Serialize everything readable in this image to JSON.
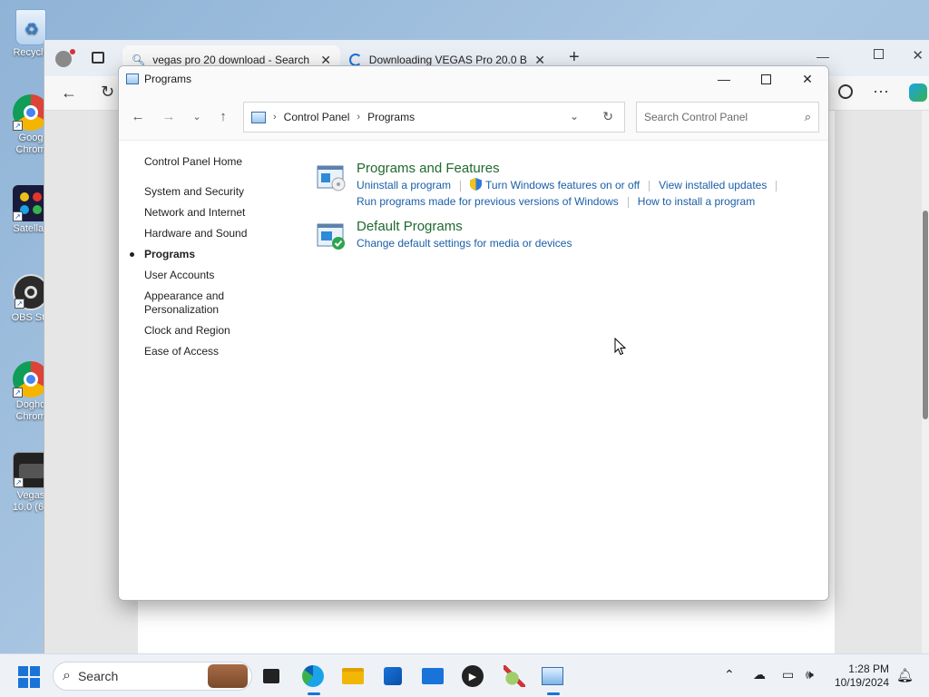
{
  "desktop": {
    "icons": [
      {
        "label": "Recycle",
        "icon": "recycle-bin-icon"
      },
      {
        "label": "Goog Chrom",
        "icon": "chrome-icon"
      },
      {
        "label": "Satellav",
        "icon": "app-icon"
      },
      {
        "label": "OBS Stu",
        "icon": "obs-icon"
      },
      {
        "label": "Dogho Chrom",
        "icon": "chrome-icon"
      },
      {
        "label": "Vegas 10.0 (64",
        "icon": "vegas-icon"
      }
    ]
  },
  "browser": {
    "tabs": [
      {
        "label": "vegas pro 20 download - Search",
        "icon": "search-icon"
      },
      {
        "label": "Downloading VEGAS Pro 20.0 Bu",
        "icon": "loading-icon"
      }
    ]
  },
  "window": {
    "title": "Programs",
    "breadcrumb": [
      "Control Panel",
      "Programs"
    ],
    "search_placeholder": "Search Control Panel"
  },
  "sidebar": {
    "home": "Control Panel Home",
    "items": [
      {
        "label": "System and Security"
      },
      {
        "label": "Network and Internet"
      },
      {
        "label": "Hardware and Sound"
      },
      {
        "label": "Programs",
        "current": true
      },
      {
        "label": "User Accounts"
      },
      {
        "label": "Appearance and Personalization"
      },
      {
        "label": "Clock and Region"
      },
      {
        "label": "Ease of Access"
      }
    ]
  },
  "sections": [
    {
      "title": "Programs and Features",
      "links_row1": [
        "Uninstall a program",
        "Turn Windows features on or off",
        "View installed updates"
      ],
      "links_row2": [
        "Run programs made for previous versions of Windows",
        "How to install a program"
      ]
    },
    {
      "title": "Default Programs",
      "links_row1": [
        "Change default settings for media or devices"
      ]
    }
  ],
  "taskbar": {
    "search_label": "Search",
    "time": "1:28 PM",
    "date": "10/19/2024"
  },
  "colors": {
    "section_title": "#1e6a2e",
    "link": "#1a5ea8",
    "accent": "#1a73d9"
  }
}
